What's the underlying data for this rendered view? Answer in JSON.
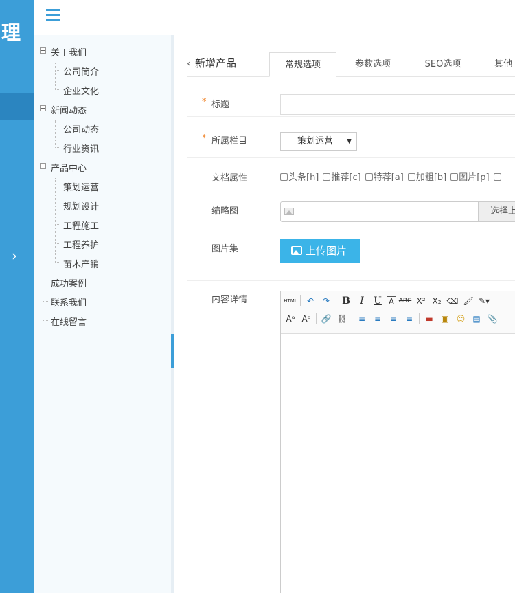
{
  "rail": {
    "logo_char": "理",
    "expand_glyph": "›"
  },
  "tree": {
    "items": [
      {
        "label": "关于我们"
      },
      {
        "label": "公司简介"
      },
      {
        "label": "企业文化"
      },
      {
        "label": "新闻动态"
      },
      {
        "label": "公司动态"
      },
      {
        "label": "行业资讯"
      },
      {
        "label": "产品中心"
      },
      {
        "label": "策划运营"
      },
      {
        "label": "规划设计"
      },
      {
        "label": "工程施工"
      },
      {
        "label": "工程养护"
      },
      {
        "label": "苗木产销"
      },
      {
        "label": "成功案例"
      },
      {
        "label": "联系我们"
      },
      {
        "label": "在线留言"
      }
    ]
  },
  "page": {
    "back_glyph": "‹",
    "title": "新增产品",
    "tabs": [
      "常规选项",
      "参数选项",
      "SEO选项",
      "其他"
    ]
  },
  "form": {
    "required_mark": "*",
    "title_label": "标题",
    "column_label": "所属栏目",
    "column_value": "策划运营",
    "select_arrow": "▼",
    "attr_label": "文档属性",
    "attrs": [
      "头条[h]",
      "推荐[c]",
      "特荐[a]",
      "加粗[b]",
      "图片[p]"
    ],
    "thumb_label": "缩略图",
    "thumb_button": "选择上",
    "gallery_label": "图片集",
    "gallery_button": "上传图片",
    "content_label": "内容详情"
  },
  "editor": {
    "row1": [
      "HTML",
      "↶",
      "↷",
      "B",
      "I",
      "U",
      "A",
      "ABC",
      "X²",
      "X₂",
      "⌫",
      "🖌",
      "✎▾"
    ],
    "row2": [
      "Aᵃ",
      "Aᵃ",
      "🔗",
      "⛓",
      "≡",
      "≡",
      "≡",
      "≡",
      "▬",
      "▣",
      "☺",
      "▤",
      "📎"
    ]
  },
  "colors": {
    "accent": "#3c9ed8",
    "upload": "#3bb4e8",
    "required": "#f0862d"
  }
}
